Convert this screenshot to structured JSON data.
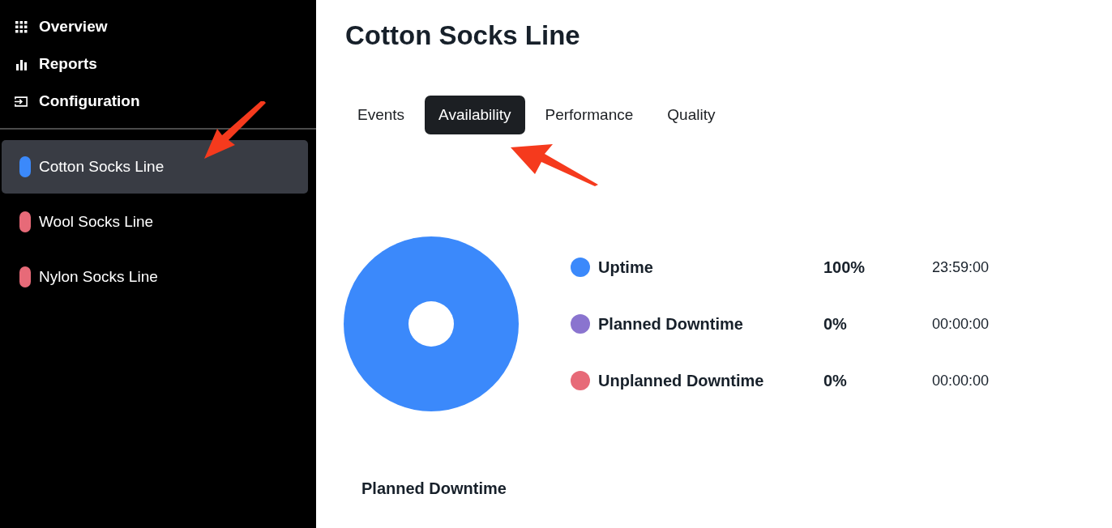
{
  "sidebar": {
    "nav": [
      {
        "label": "Overview"
      },
      {
        "label": "Reports"
      },
      {
        "label": "Configuration"
      }
    ],
    "lines": [
      {
        "label": "Cotton Socks Line",
        "color": "#3b89fb",
        "selected": true
      },
      {
        "label": "Wool Socks Line",
        "color": "#e76a78",
        "selected": false
      },
      {
        "label": "Nylon Socks Line",
        "color": "#e76a78",
        "selected": false
      }
    ]
  },
  "title": "Cotton Socks Line",
  "tabs": [
    {
      "label": "Events",
      "selected": false
    },
    {
      "label": "Availability",
      "selected": true
    },
    {
      "label": "Performance",
      "selected": false
    },
    {
      "label": "Quality",
      "selected": false
    }
  ],
  "availability": {
    "chart_data": {
      "type": "donut",
      "values": [
        100,
        0,
        0
      ]
    },
    "legend": [
      {
        "label": "Uptime",
        "percent": "100%",
        "duration": "23:59:00",
        "color": "#3b89fb"
      },
      {
        "label": "Planned Downtime",
        "percent": "0%",
        "duration": "00:00:00",
        "color": "#8a74cf"
      },
      {
        "label": "Unplanned Downtime",
        "percent": "0%",
        "duration": "00:00:00",
        "color": "#e76a78"
      }
    ]
  },
  "section_heading": "Planned Downtime"
}
